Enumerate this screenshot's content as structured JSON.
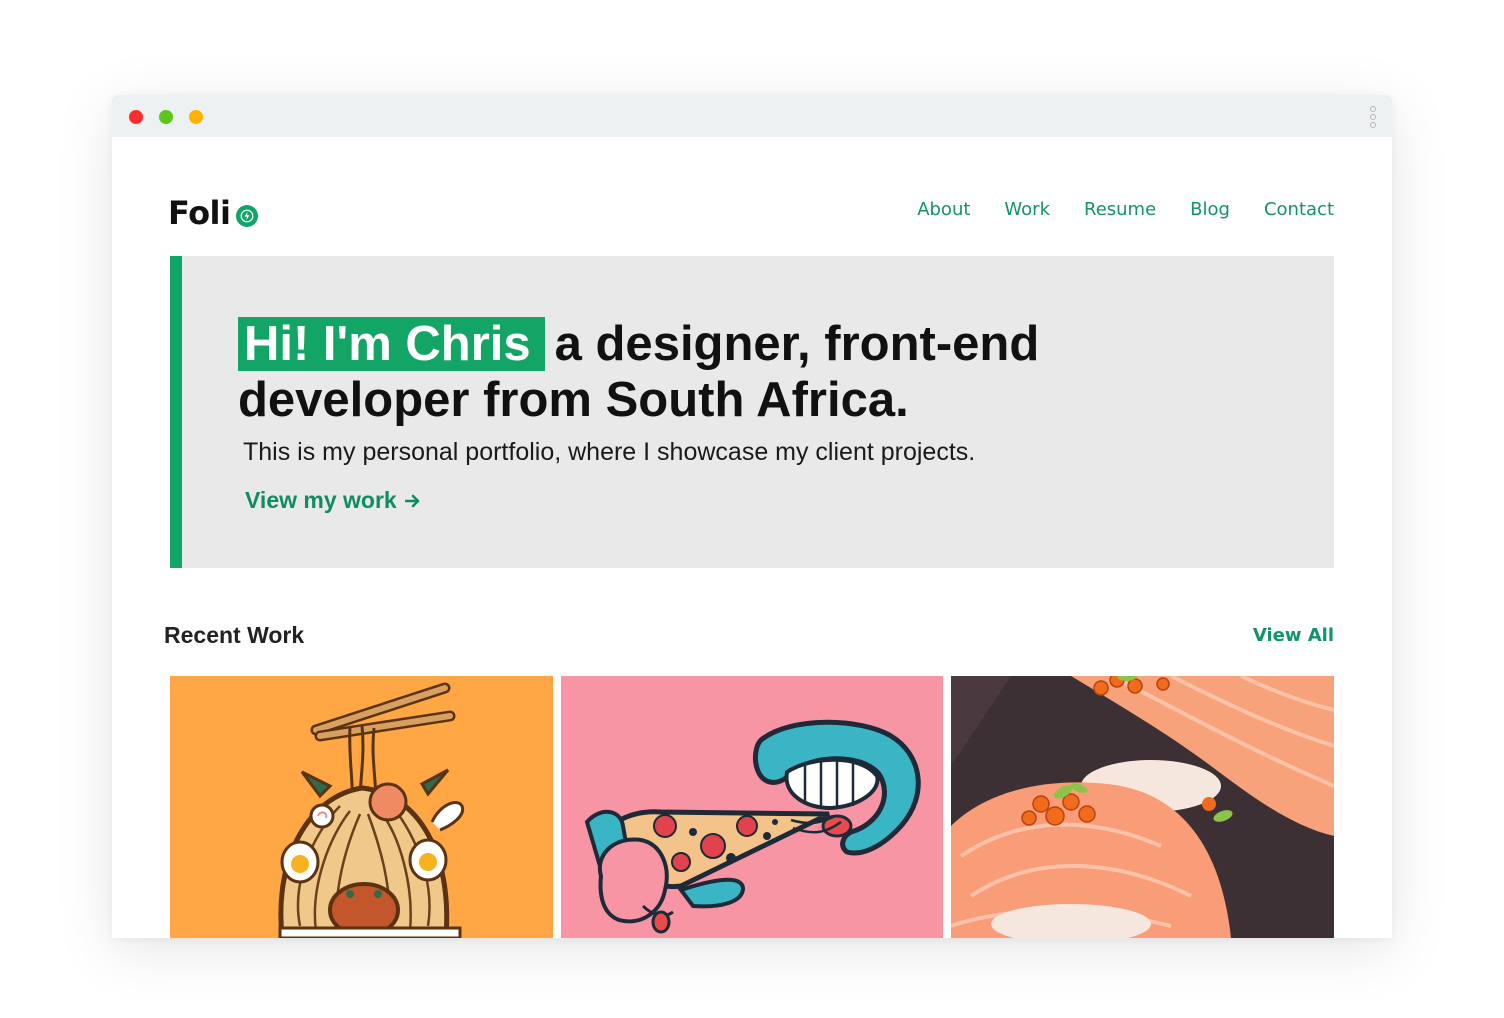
{
  "logo": {
    "text": "Foli"
  },
  "nav": {
    "items": [
      "About",
      "Work",
      "Resume",
      "Blog",
      "Contact"
    ]
  },
  "hero": {
    "highlight": "Hi! I'm Chris",
    "title_rest": "a designer, front-end developer from South Africa.",
    "subtitle": "This is my personal portfolio, where I showcase my client projects.",
    "cta": "View my work"
  },
  "recent": {
    "title": "Recent Work",
    "view_all": "View All",
    "items": [
      {
        "icon": "ramen-illustration",
        "background": "#ffa745"
      },
      {
        "icon": "pizza-mouth-illustration",
        "background": "#f895a5"
      },
      {
        "icon": "salmon-sushi-illustration",
        "background": "#3d3035"
      }
    ]
  },
  "colors": {
    "accent": "#12a56a",
    "link": "#109469",
    "hero_bg": "#e9e9e9"
  }
}
